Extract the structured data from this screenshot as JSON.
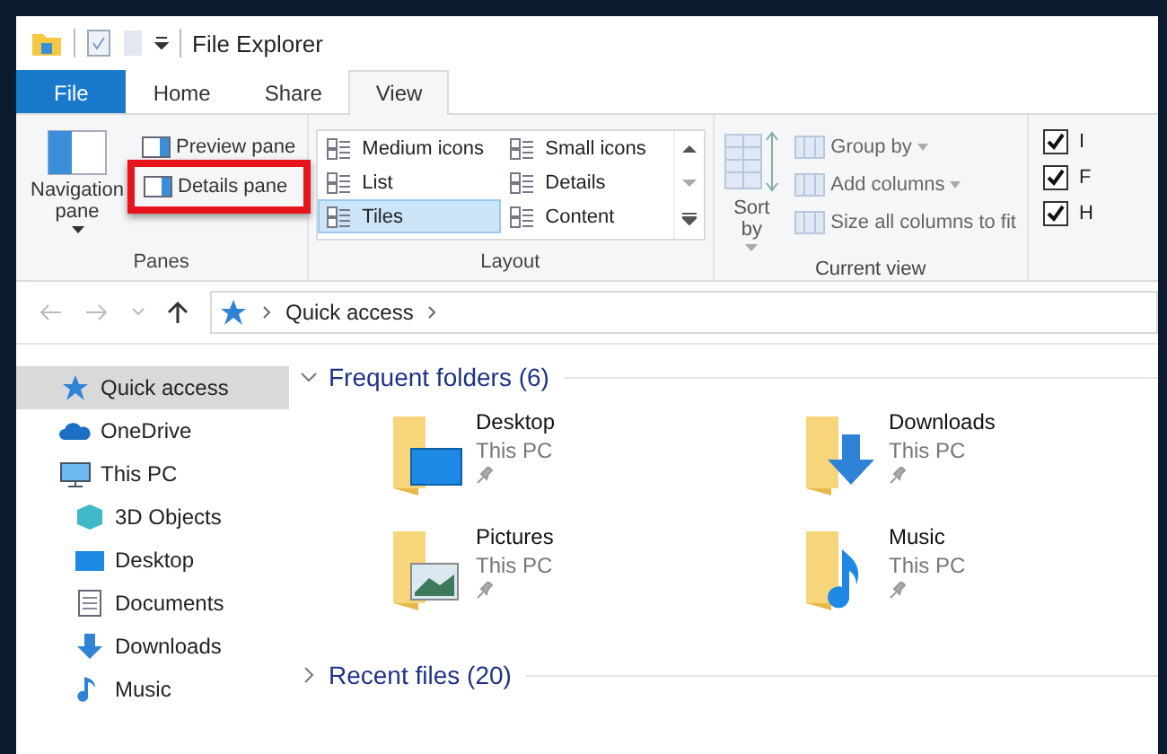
{
  "title_bar": {
    "title": "File Explorer"
  },
  "tabs": [
    {
      "label": "File",
      "kind": "file",
      "selected": false
    },
    {
      "label": "Home",
      "kind": "tab",
      "selected": false
    },
    {
      "label": "Share",
      "kind": "tab",
      "selected": false
    },
    {
      "label": "View",
      "kind": "tab",
      "selected": true
    }
  ],
  "ribbon": {
    "panes": {
      "label": "Panes",
      "navigation_pane": "Navigation pane",
      "items": [
        {
          "label": "Preview pane",
          "highlighted": false
        },
        {
          "label": "Details pane",
          "highlighted": true
        }
      ]
    },
    "layout": {
      "label": "Layout",
      "options": [
        {
          "label": "Medium icons",
          "selected": false
        },
        {
          "label": "Small icons",
          "selected": false
        },
        {
          "label": "List",
          "selected": false
        },
        {
          "label": "Details",
          "selected": false
        },
        {
          "label": "Tiles",
          "selected": true
        },
        {
          "label": "Content",
          "selected": false
        }
      ]
    },
    "current_view": {
      "label": "Current view",
      "sort_by": "Sort by",
      "commands": [
        {
          "label": "Group by",
          "dropdown": true
        },
        {
          "label": "Add columns",
          "dropdown": true
        },
        {
          "label": "Size all columns to fit",
          "dropdown": false
        }
      ]
    },
    "show_hide": {
      "checkboxes": [
        {
          "label": "I",
          "checked": true
        },
        {
          "label": "F",
          "checked": true
        },
        {
          "label": "H",
          "checked": true
        }
      ]
    }
  },
  "address_bar": {
    "path": "Quick access"
  },
  "nav_pane": {
    "items": [
      {
        "label": "Quick access",
        "kind": "star",
        "selected": true
      },
      {
        "label": "OneDrive",
        "kind": "cloud",
        "selected": false
      },
      {
        "label": "This PC",
        "kind": "pc",
        "selected": false,
        "children": [
          {
            "label": "3D Objects",
            "kind": "cube",
            "selected": false
          },
          {
            "label": "Desktop",
            "kind": "desktop",
            "selected": false
          },
          {
            "label": "Documents",
            "kind": "document",
            "selected": false
          },
          {
            "label": "Downloads",
            "kind": "download",
            "selected": false
          },
          {
            "label": "Music",
            "kind": "music",
            "selected": false
          }
        ]
      }
    ]
  },
  "content": {
    "groups": [
      {
        "title": "Frequent folders (6)",
        "expanded": true,
        "folders": [
          {
            "name": "Desktop",
            "location": "This PC",
            "kind": "desktop",
            "pinned": true
          },
          {
            "name": "Downloads",
            "location": "This PC",
            "kind": "download",
            "pinned": true
          },
          {
            "name": "Pictures",
            "location": "This PC",
            "kind": "picture",
            "pinned": true
          },
          {
            "name": "Music",
            "location": "This PC",
            "kind": "music",
            "pinned": true
          }
        ]
      },
      {
        "title": "Recent files (20)",
        "expanded": false
      }
    ]
  }
}
